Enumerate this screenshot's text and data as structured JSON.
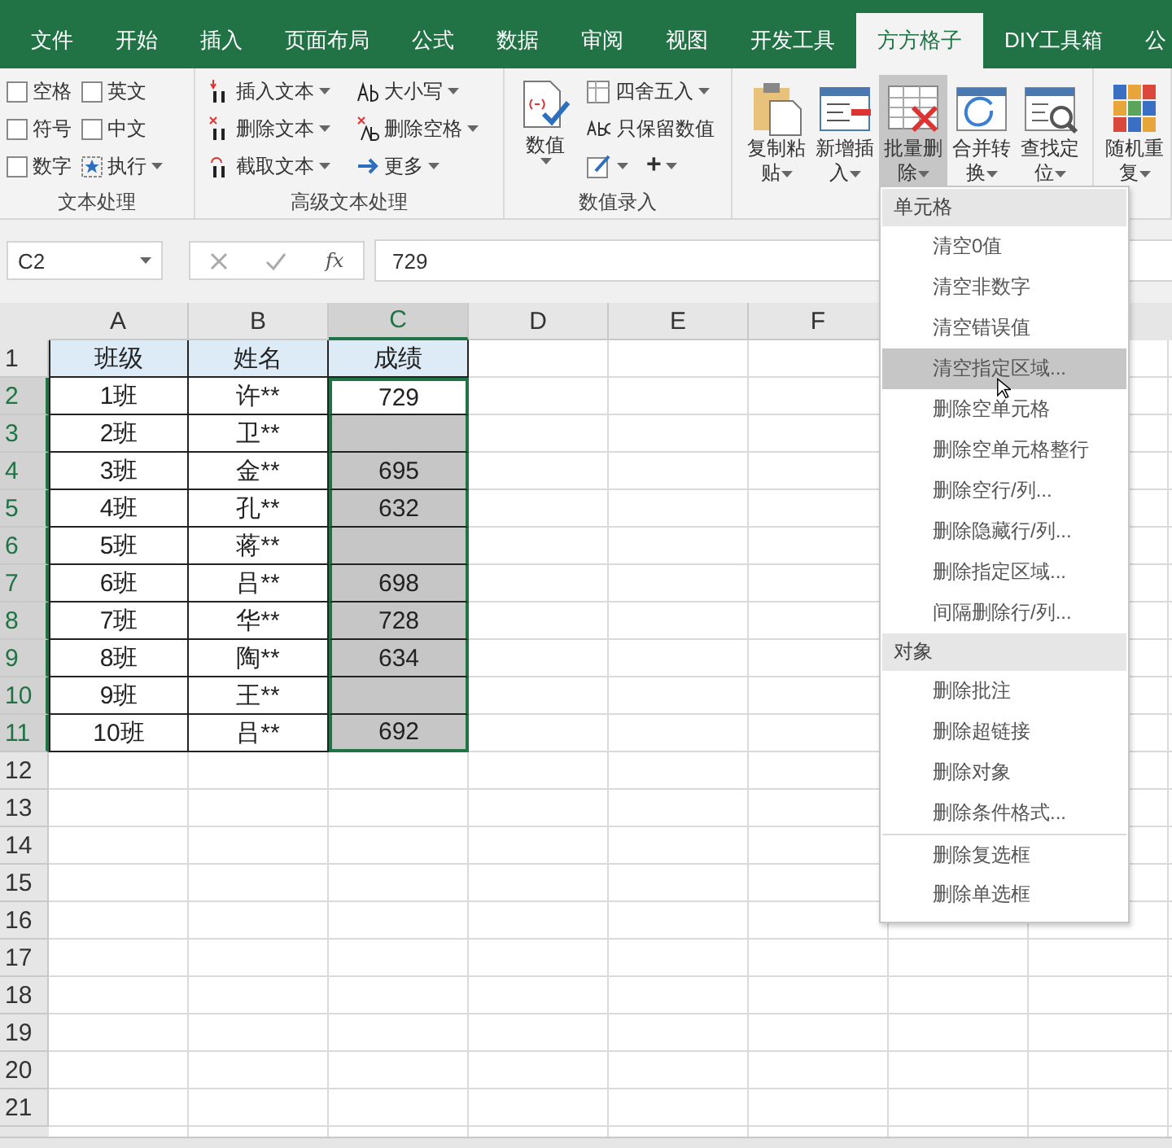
{
  "ribbon_tabs": [
    {
      "label": "文件",
      "selected": false
    },
    {
      "label": "开始",
      "selected": false
    },
    {
      "label": "插入",
      "selected": false
    },
    {
      "label": "页面布局",
      "selected": false
    },
    {
      "label": "公式",
      "selected": false
    },
    {
      "label": "数据",
      "selected": false
    },
    {
      "label": "审阅",
      "selected": false
    },
    {
      "label": "视图",
      "selected": false
    },
    {
      "label": "开发工具",
      "selected": false
    },
    {
      "label": "方方格子",
      "selected": true
    },
    {
      "label": "DIY工具箱",
      "selected": false
    },
    {
      "label": "公",
      "selected": false
    }
  ],
  "text_processing": {
    "label": "文本处理",
    "checkboxes": [
      {
        "label": "空格",
        "checked": false
      },
      {
        "label": "英文",
        "checked": false
      },
      {
        "label": "符号",
        "checked": false
      },
      {
        "label": "中文",
        "checked": false
      },
      {
        "label": "数字",
        "checked": false
      }
    ],
    "run_button": "执行"
  },
  "advanced_text": {
    "label": "高级文本处理",
    "buttons": [
      {
        "label": "插入文本"
      },
      {
        "label": "大小写"
      },
      {
        "label": "删除文本"
      },
      {
        "label": "删除空格"
      },
      {
        "label": "截取文本"
      },
      {
        "label": "更多"
      }
    ]
  },
  "number_entry": {
    "label": "数值录入",
    "big_button": "数值",
    "round_button": "四舍五入",
    "keep_button": "只保留数值",
    "plus_button": "+"
  },
  "tools": [
    {
      "label": "复制粘贴",
      "pressed": false
    },
    {
      "label": "新增插入",
      "pressed": false
    },
    {
      "label": "批量删除",
      "pressed": true
    },
    {
      "label": "合并转换",
      "pressed": false
    },
    {
      "label": "查找定位",
      "pressed": false
    },
    {
      "label": "随机重复",
      "pressed": false
    }
  ],
  "formula_bar": {
    "name_box": "C2",
    "fx": "fx",
    "value": "729"
  },
  "sheet": {
    "columns": [
      {
        "label": "A",
        "selected": false
      },
      {
        "label": "B",
        "selected": false
      },
      {
        "label": "C",
        "selected": true
      },
      {
        "label": "D",
        "selected": false
      },
      {
        "label": "E",
        "selected": false
      },
      {
        "label": "F",
        "selected": false
      }
    ],
    "rows": [
      {
        "label": "1",
        "selected": false,
        "cells": [
          {
            "text": "班级",
            "kind": "header",
            "selected": false
          },
          {
            "text": "姓名",
            "kind": "header",
            "selected": false
          },
          {
            "text": "成绩",
            "kind": "header",
            "selected": false
          }
        ]
      },
      {
        "label": "2",
        "selected": true,
        "cells": [
          {
            "text": "1班",
            "kind": "data",
            "selected": false
          },
          {
            "text": "许**",
            "kind": "data",
            "selected": false
          },
          {
            "text": "729",
            "kind": "data",
            "selected": true,
            "active": true
          }
        ]
      },
      {
        "label": "3",
        "selected": true,
        "cells": [
          {
            "text": "2班",
            "kind": "data",
            "selected": false
          },
          {
            "text": "卫**",
            "kind": "data",
            "selected": false
          },
          {
            "text": "",
            "kind": "data",
            "selected": true
          }
        ]
      },
      {
        "label": "4",
        "selected": true,
        "cells": [
          {
            "text": "3班",
            "kind": "data",
            "selected": false
          },
          {
            "text": "金**",
            "kind": "data",
            "selected": false
          },
          {
            "text": "695",
            "kind": "data",
            "selected": true
          }
        ]
      },
      {
        "label": "5",
        "selected": true,
        "cells": [
          {
            "text": "4班",
            "kind": "data",
            "selected": false
          },
          {
            "text": "孔**",
            "kind": "data",
            "selected": false
          },
          {
            "text": "632",
            "kind": "data",
            "selected": true
          }
        ]
      },
      {
        "label": "6",
        "selected": true,
        "cells": [
          {
            "text": "5班",
            "kind": "data",
            "selected": false
          },
          {
            "text": "蒋**",
            "kind": "data",
            "selected": false
          },
          {
            "text": "",
            "kind": "data",
            "selected": true
          }
        ]
      },
      {
        "label": "7",
        "selected": true,
        "cells": [
          {
            "text": "6班",
            "kind": "data",
            "selected": false
          },
          {
            "text": "吕**",
            "kind": "data",
            "selected": false
          },
          {
            "text": "698",
            "kind": "data",
            "selected": true
          }
        ]
      },
      {
        "label": "8",
        "selected": true,
        "cells": [
          {
            "text": "7班",
            "kind": "data",
            "selected": false
          },
          {
            "text": "华**",
            "kind": "data",
            "selected": false
          },
          {
            "text": "728",
            "kind": "data",
            "selected": true
          }
        ]
      },
      {
        "label": "9",
        "selected": true,
        "cells": [
          {
            "text": "8班",
            "kind": "data",
            "selected": false
          },
          {
            "text": "陶**",
            "kind": "data",
            "selected": false
          },
          {
            "text": "634",
            "kind": "data",
            "selected": true
          }
        ]
      },
      {
        "label": "10",
        "selected": true,
        "cells": [
          {
            "text": "9班",
            "kind": "data",
            "selected": false
          },
          {
            "text": "王**",
            "kind": "data",
            "selected": false
          },
          {
            "text": "",
            "kind": "data",
            "selected": true
          }
        ]
      },
      {
        "label": "11",
        "selected": true,
        "cells": [
          {
            "text": "10班",
            "kind": "data",
            "selected": false
          },
          {
            "text": "吕**",
            "kind": "data",
            "selected": false
          },
          {
            "text": "692",
            "kind": "data",
            "selected": true
          }
        ]
      },
      {
        "label": "12",
        "selected": false,
        "cells": []
      },
      {
        "label": "13",
        "selected": false,
        "cells": []
      },
      {
        "label": "14",
        "selected": false,
        "cells": []
      },
      {
        "label": "15",
        "selected": false,
        "cells": []
      },
      {
        "label": "16",
        "selected": false,
        "cells": []
      },
      {
        "label": "17",
        "selected": false,
        "cells": []
      },
      {
        "label": "18",
        "selected": false,
        "cells": []
      },
      {
        "label": "19",
        "selected": false,
        "cells": []
      },
      {
        "label": "20",
        "selected": false,
        "cells": []
      },
      {
        "label": "21",
        "selected": false,
        "cells": []
      }
    ]
  },
  "menu": {
    "sections": [
      {
        "title": "单元格",
        "items": [
          {
            "label": "清空0值",
            "highlighted": false
          },
          {
            "label": "清空非数字",
            "highlighted": false
          },
          {
            "label": "清空错误值",
            "highlighted": false
          },
          {
            "label": "清空指定区域...",
            "highlighted": true
          },
          {
            "label": "删除空单元格",
            "highlighted": false
          },
          {
            "label": "删除空单元格整行",
            "highlighted": false
          },
          {
            "label": "删除空行/列...",
            "highlighted": false
          },
          {
            "label": "删除隐藏行/列...",
            "highlighted": false
          },
          {
            "label": "删除指定区域...",
            "highlighted": false
          },
          {
            "label": "间隔删除行/列...",
            "highlighted": false
          }
        ]
      },
      {
        "title": "对象",
        "items": [
          {
            "label": "删除批注",
            "highlighted": false
          },
          {
            "label": "删除超链接",
            "highlighted": false
          },
          {
            "label": "删除对象",
            "highlighted": false
          },
          {
            "label": "删除条件格式...",
            "highlighted": false
          },
          {
            "label": "删除复选框",
            "highlighted": false,
            "separator_before": true
          },
          {
            "label": "删除单选框",
            "highlighted": false
          }
        ]
      }
    ]
  }
}
